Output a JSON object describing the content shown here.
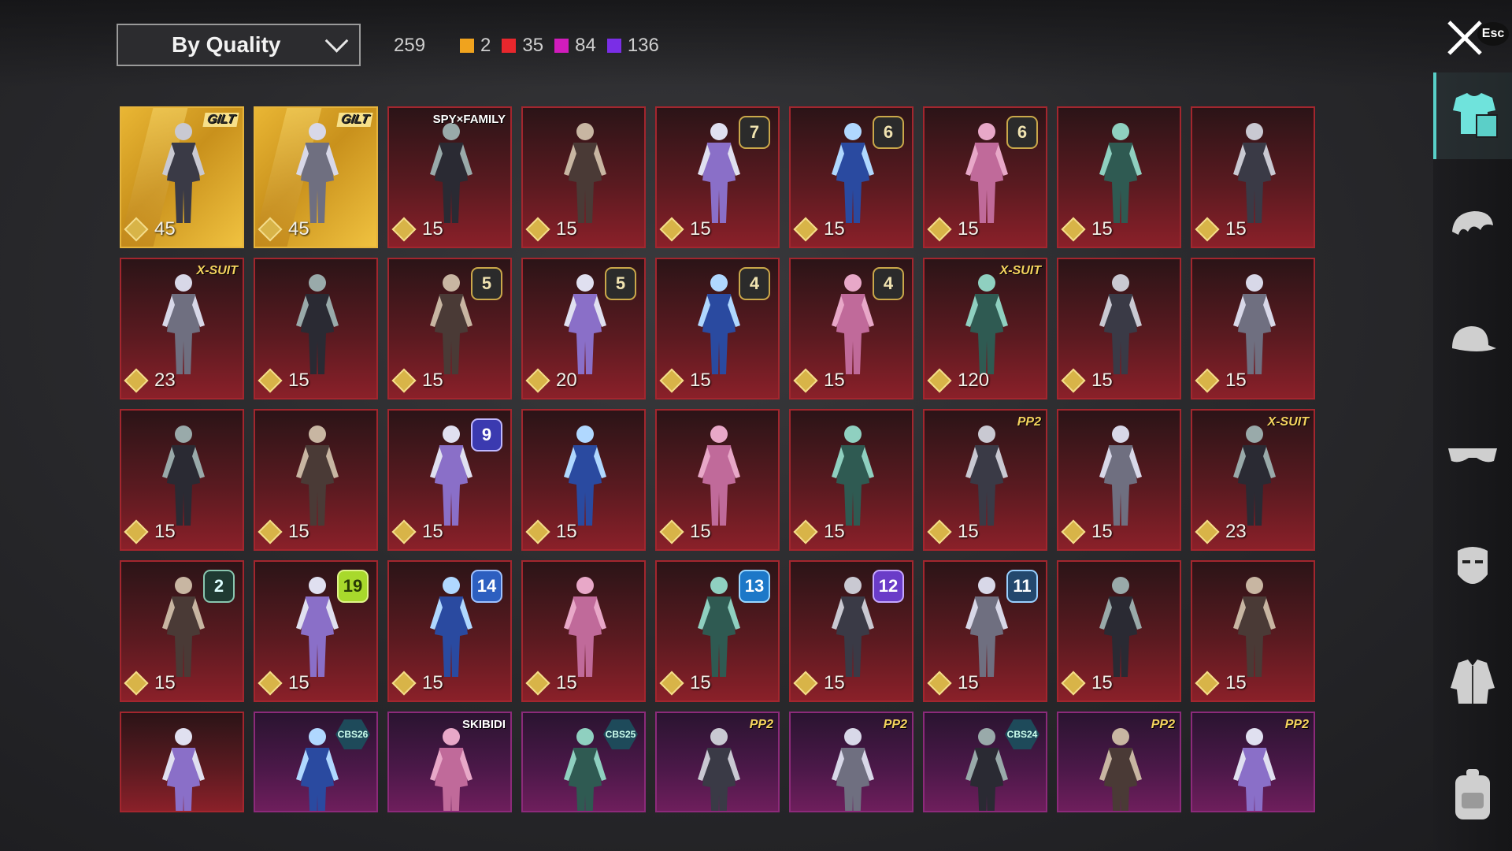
{
  "sort": {
    "label": "By Quality"
  },
  "counts": {
    "total": "259",
    "qualities": [
      {
        "value": "2",
        "color": "#f0a31e"
      },
      {
        "value": "35",
        "color": "#e8272d"
      },
      {
        "value": "84",
        "color": "#d11cbc"
      },
      {
        "value": "136",
        "color": "#7a2ee6"
      }
    ]
  },
  "close": {
    "esc_label": "Esc"
  },
  "items": [
    {
      "points": "45",
      "style": "gold",
      "badge": {
        "kind": "tag",
        "text": "GILT",
        "variant": "gilt"
      }
    },
    {
      "points": "45",
      "style": "gold",
      "badge": {
        "kind": "tag",
        "text": "GILT",
        "variant": "gilt"
      }
    },
    {
      "points": "15",
      "style": "red",
      "badge": {
        "kind": "tag",
        "text": "SPY×FAMILY",
        "variant": "white"
      }
    },
    {
      "points": "15",
      "style": "red"
    },
    {
      "points": "15",
      "style": "red",
      "badge": {
        "kind": "num",
        "text": "7"
      }
    },
    {
      "points": "15",
      "style": "red",
      "badge": {
        "kind": "num",
        "text": "6"
      }
    },
    {
      "points": "15",
      "style": "red",
      "badge": {
        "kind": "num",
        "text": "6"
      }
    },
    {
      "points": "15",
      "style": "red"
    },
    {
      "points": "15",
      "style": "red"
    },
    {
      "points": "23",
      "style": "red",
      "badge": {
        "kind": "tag",
        "text": "X-SUIT"
      }
    },
    {
      "points": "15",
      "style": "red"
    },
    {
      "points": "15",
      "style": "red",
      "badge": {
        "kind": "num",
        "text": "5"
      }
    },
    {
      "points": "20",
      "style": "red",
      "badge": {
        "kind": "num",
        "text": "5"
      }
    },
    {
      "points": "15",
      "style": "red",
      "badge": {
        "kind": "num",
        "text": "4"
      }
    },
    {
      "points": "15",
      "style": "red",
      "badge": {
        "kind": "num",
        "text": "4"
      }
    },
    {
      "points": "120",
      "style": "red",
      "badge": {
        "kind": "tag",
        "text": "X-SUIT"
      }
    },
    {
      "points": "15",
      "style": "red"
    },
    {
      "points": "15",
      "style": "red"
    },
    {
      "points": "15",
      "style": "red"
    },
    {
      "points": "15",
      "style": "red"
    },
    {
      "points": "15",
      "style": "red",
      "badge": {
        "kind": "num",
        "text": "9",
        "variant": "s9"
      }
    },
    {
      "points": "15",
      "style": "red"
    },
    {
      "points": "15",
      "style": "red"
    },
    {
      "points": "15",
      "style": "red"
    },
    {
      "points": "15",
      "style": "red",
      "badge": {
        "kind": "tag",
        "text": "PP2"
      }
    },
    {
      "points": "15",
      "style": "red"
    },
    {
      "points": "23",
      "style": "red",
      "badge": {
        "kind": "tag",
        "text": "X-SUIT"
      }
    },
    {
      "points": "15",
      "style": "red",
      "badge": {
        "kind": "num",
        "text": "2",
        "variant": "s2"
      }
    },
    {
      "points": "15",
      "style": "red",
      "badge": {
        "kind": "num",
        "text": "19",
        "variant": "s19"
      }
    },
    {
      "points": "15",
      "style": "red",
      "badge": {
        "kind": "num",
        "text": "14",
        "variant": "s14"
      }
    },
    {
      "points": "15",
      "style": "red"
    },
    {
      "points": "15",
      "style": "red",
      "badge": {
        "kind": "num",
        "text": "13",
        "variant": "s13"
      }
    },
    {
      "points": "15",
      "style": "red",
      "badge": {
        "kind": "num",
        "text": "12",
        "variant": "s12"
      }
    },
    {
      "points": "15",
      "style": "red",
      "badge": {
        "kind": "num",
        "text": "11",
        "variant": "s11"
      }
    },
    {
      "points": "15",
      "style": "red"
    },
    {
      "points": "15",
      "style": "red"
    },
    {
      "style": "red",
      "partial": true
    },
    {
      "style": "purple",
      "partial": true,
      "badge": {
        "kind": "hex",
        "text": "CBS26"
      }
    },
    {
      "style": "purple",
      "partial": true,
      "badge": {
        "kind": "tag",
        "text": "SKIBIDI",
        "variant": "white"
      }
    },
    {
      "style": "purple",
      "partial": true,
      "badge": {
        "kind": "hex",
        "text": "CBS25"
      }
    },
    {
      "style": "purple",
      "partial": true,
      "badge": {
        "kind": "tag",
        "text": "PP2"
      }
    },
    {
      "style": "purple",
      "partial": true,
      "badge": {
        "kind": "tag",
        "text": "PP2"
      }
    },
    {
      "style": "purple",
      "partial": true,
      "badge": {
        "kind": "hex",
        "text": "CBS24"
      }
    },
    {
      "style": "purple",
      "partial": true,
      "badge": {
        "kind": "tag",
        "text": "PP2"
      }
    },
    {
      "style": "purple",
      "partial": true,
      "badge": {
        "kind": "tag",
        "text": "PP2"
      }
    }
  ],
  "rail": [
    {
      "name": "outfit-icon",
      "active": true
    },
    {
      "name": "hair-icon"
    },
    {
      "name": "cap-icon"
    },
    {
      "name": "glasses-icon"
    },
    {
      "name": "mask-icon"
    },
    {
      "name": "jacket-icon"
    },
    {
      "name": "backpack-icon"
    }
  ]
}
